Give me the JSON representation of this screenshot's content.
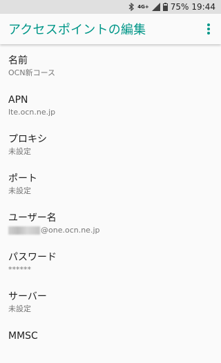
{
  "status": {
    "network": "4G+",
    "battery": "75%",
    "time": "19:44",
    "icons": [
      "bluetooth-icon",
      "signal-icon",
      "battery-icon"
    ]
  },
  "appbar": {
    "title": "アクセスポイントの編集",
    "menu_icon": "more-vert-icon",
    "accent": "#009688"
  },
  "items": [
    {
      "label": "名前",
      "value": "OCN新コース"
    },
    {
      "label": "APN",
      "value": "lte.ocn.ne.jp"
    },
    {
      "label": "プロキシ",
      "value": "未設定"
    },
    {
      "label": "ポート",
      "value": "未設定"
    },
    {
      "label": "ユーザー名",
      "value": "@one.ocn.ne.jp"
    },
    {
      "label": "パスワード",
      "value": "******"
    },
    {
      "label": "サーバー",
      "value": "未設定"
    },
    {
      "label": "MMSC",
      "value": ""
    }
  ]
}
